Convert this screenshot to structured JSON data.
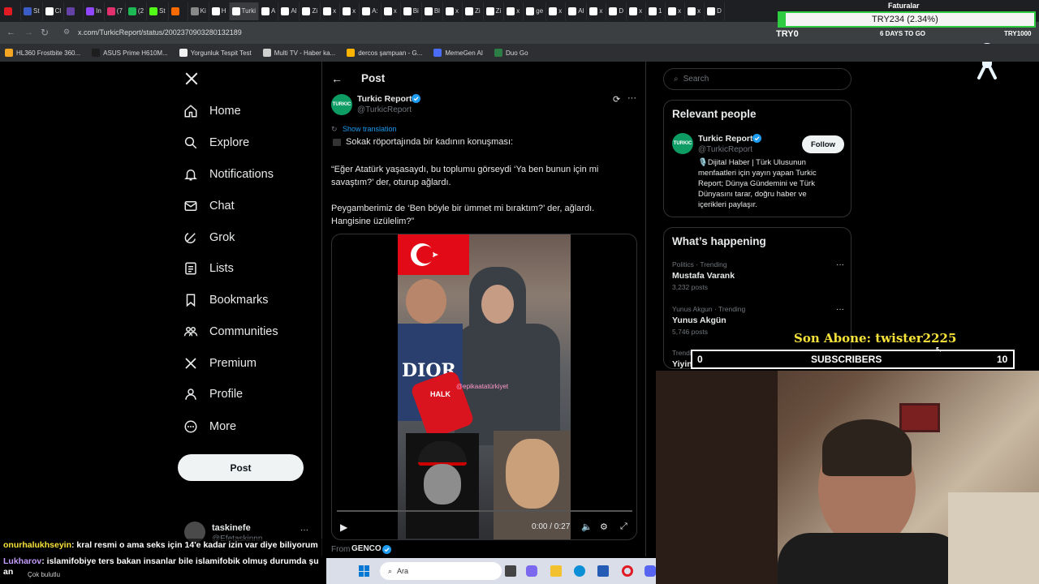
{
  "tabs": [
    {
      "label": "",
      "color": "#e01b24"
    },
    {
      "label": "St",
      "color": "#3b5cc5"
    },
    {
      "label": "Cl",
      "color": "#ffffff"
    },
    {
      "label": "",
      "color": "#6441a5"
    },
    {
      "label": "In",
      "color": "#9146ff"
    },
    {
      "label": "(7",
      "color": "#e1306c"
    },
    {
      "label": "(2",
      "color": "#1db954"
    },
    {
      "label": "St",
      "color": "#53fc18"
    },
    {
      "label": "",
      "color": "#ff6a00"
    },
    {
      "label": "Ki",
      "color": "#888888"
    },
    {
      "label": "H",
      "color": "#ffffff"
    },
    {
      "label": "Turki",
      "color": "#ffffff"
    },
    {
      "label": "A",
      "color": "#ffffff"
    },
    {
      "label": "Al",
      "color": "#ffffff"
    },
    {
      "label": "Zi",
      "color": "#ffffff"
    },
    {
      "label": "x",
      "color": "#ffffff"
    },
    {
      "label": "x",
      "color": "#ffffff"
    },
    {
      "label": "A:",
      "color": "#ffffff"
    },
    {
      "label": "x",
      "color": "#ffffff"
    },
    {
      "label": "Bi",
      "color": "#ffffff"
    },
    {
      "label": "Bl",
      "color": "#ffffff"
    },
    {
      "label": "x",
      "color": "#ffffff"
    },
    {
      "label": "Zi",
      "color": "#ffffff"
    },
    {
      "label": "Zi",
      "color": "#ffffff"
    },
    {
      "label": "x",
      "color": "#ffffff"
    },
    {
      "label": "ge",
      "color": "#ffffff"
    },
    {
      "label": "x",
      "color": "#ffffff"
    },
    {
      "label": "Al",
      "color": "#ffffff"
    },
    {
      "label": "x",
      "color": "#ffffff"
    },
    {
      "label": "D",
      "color": "#ffffff"
    },
    {
      "label": "x",
      "color": "#ffffff"
    },
    {
      "label": "1",
      "color": "#ffffff"
    },
    {
      "label": "x",
      "color": "#ffffff"
    },
    {
      "label": "x",
      "color": "#ffffff"
    },
    {
      "label": "D",
      "color": "#ffffff"
    }
  ],
  "browser": {
    "url": "x.com/TurkicReport/status/2002370903280132189",
    "bookmarks": [
      "HL360 Frostbite 360...",
      "ASUS Prime H610M...",
      "Yorgunluk Tespit Test",
      "Multi TV - Haber ka...",
      "dercos şampuan - G...",
      "MemeGen AI",
      "Duo Go"
    ]
  },
  "ticker": {
    "text": "TRY234 (2.34%)",
    "label": "TRY0",
    "days": "6 DAYS TO GO",
    "right": "TRY1000",
    "faturalar": "Faturalar"
  },
  "nav": {
    "items": [
      {
        "label": "Home",
        "icon": "home-icon"
      },
      {
        "label": "Explore",
        "icon": "search-icon"
      },
      {
        "label": "Notifications",
        "icon": "bell-icon"
      },
      {
        "label": "Chat",
        "icon": "mail-icon"
      },
      {
        "label": "Grok",
        "icon": "grok-icon"
      },
      {
        "label": "Lists",
        "icon": "list-icon"
      },
      {
        "label": "Bookmarks",
        "icon": "bookmark-icon"
      },
      {
        "label": "Communities",
        "icon": "communities-icon"
      },
      {
        "label": "Premium",
        "icon": "x-icon"
      },
      {
        "label": "Profile",
        "icon": "person-icon"
      },
      {
        "label": "More",
        "icon": "more-icon"
      }
    ],
    "post_label": "Post",
    "account_name": "taskinefe",
    "account_handle": "@Efetaskinnn"
  },
  "post": {
    "header": "Post",
    "author": "Turkic Report",
    "handle": "@TurkicReport",
    "show_translation": "Show translation",
    "line1": "Sokak röportajında bir kadının konuşması:",
    "line2": "“Eğer Atatürk yaşasaydı, bu toplumu görseydi ‘Ya ben bunun için mi savaştım?’ der, oturup ağlardı.",
    "line3": "Peygamberimiz de ‘Ben böyle bir ümmet mi bıraktım?’ der, ağlardı. Hangisine üzülelim?”",
    "video_time": "0:00 / 0:27",
    "video_caption": "@epikaatatürkiyet",
    "mic_logo": "HALK",
    "from_label": "From",
    "from_name": "GENCO"
  },
  "sidebar": {
    "search_placeholder": "Search",
    "relevant_title": "Relevant people",
    "person_name": "Turkic Report",
    "person_handle": "@TurkicReport",
    "follow_label": "Follow",
    "bio": "🎙️Dijital Haber | Türk Ulusunun menfaatleri için yayın yapan Turkic Report; Dünya Gündemini ve Türk Dünyasını tarar, doğru haber ve içerikleri paylaşır.",
    "happening_title": "What’s happening",
    "trends": [
      {
        "meta": "Politics · Trending",
        "name": "Mustafa Varank",
        "posts": "3,232 posts"
      },
      {
        "meta": "Yunus Akgun · Trending",
        "name": "Yunus Akgün",
        "posts": "5,746 posts"
      },
      {
        "meta": "Trending in Turkey",
        "name": "Yiyin",
        "posts": ""
      }
    ]
  },
  "overlay": {
    "son_abone": "Son Abone: twister2225",
    "sub_left": "0",
    "sub_label": "SUBSCRIBERS",
    "sub_right": "10"
  },
  "chat": [
    {
      "user": "onurhalukhseyin",
      "msg": ": kral resmi o ama seks için 14'e kadar izin var diye biliyorum"
    },
    {
      "user": "Lukharov",
      "msg": ": islamifobiye ters bakan insanlar bile islamifobik olmuş durumda şu an"
    }
  ],
  "weather": "Çok bulutlu",
  "taskbar": {
    "search": "Ara"
  },
  "colors": {
    "accent": "#1d9bf0",
    "ticker": "#2ecc40",
    "sub_bar": "#ffe000"
  }
}
